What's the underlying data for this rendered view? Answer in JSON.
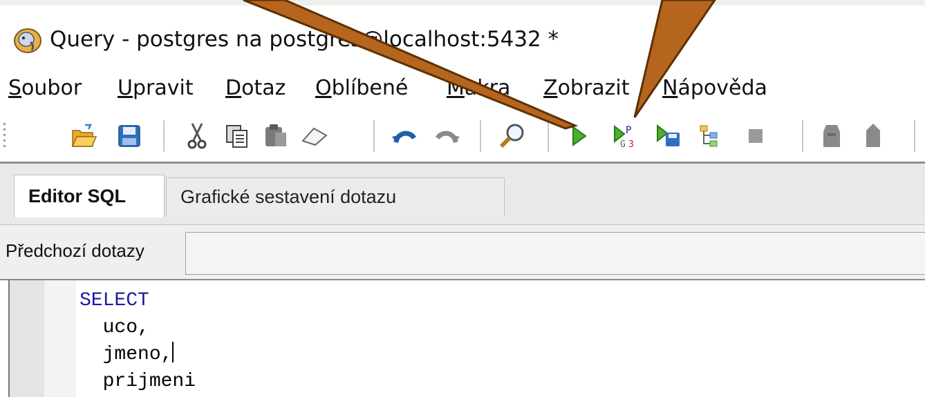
{
  "window": {
    "title": "Query - postgres na postgres@localhost:5432 *"
  },
  "menu": {
    "items": [
      {
        "first": "S",
        "rest": "oubor"
      },
      {
        "first": "U",
        "rest": "pravit"
      },
      {
        "first": "D",
        "rest": "otaz"
      },
      {
        "first": "O",
        "rest": "blíbené"
      },
      {
        "first": "M",
        "rest": "akra"
      },
      {
        "first": "Z",
        "rest": "obrazit"
      },
      {
        "first": "N",
        "rest": "ápověda"
      }
    ]
  },
  "toolbar": {
    "icons": [
      "open-folder-icon",
      "save-icon",
      "cut-icon",
      "copy-icon",
      "paste-icon",
      "clear-icon",
      "undo-icon",
      "redo-icon",
      "find-icon",
      "execute-icon",
      "execute-pgscript-icon",
      "execute-to-file-icon",
      "explain-icon",
      "cancel-icon",
      "macro-icon",
      "macro-2-icon"
    ]
  },
  "tabs": [
    {
      "label": "Editor SQL",
      "active": true
    },
    {
      "label": "Grafické sestavení dotazu",
      "active": false
    }
  ],
  "previous_queries": {
    "label": "Předchozí dotazy",
    "value": ""
  },
  "editor": {
    "lines": [
      "SELECT",
      "  uco,",
      "  jmeno,",
      "  prijmeni"
    ]
  },
  "colors": {
    "annotation_arrow": "#b5651d",
    "keyword": "#1a1a9e"
  }
}
